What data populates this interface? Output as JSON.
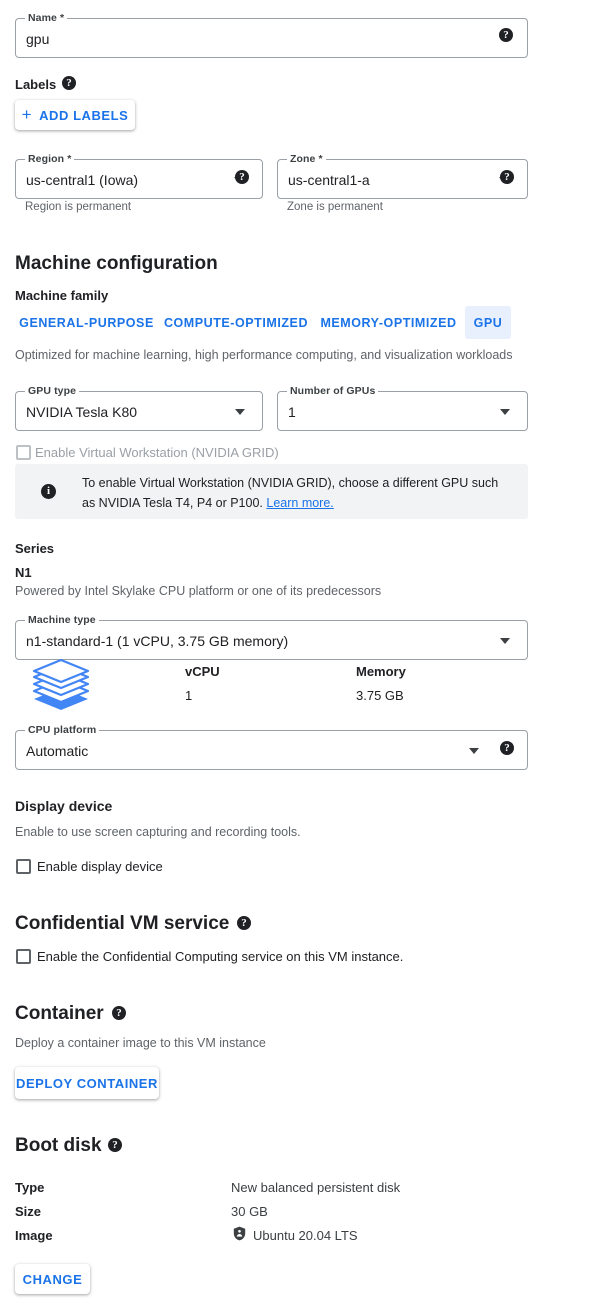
{
  "name_field": {
    "label": "Name *",
    "value": "gpu",
    "help_icon": "help-icon"
  },
  "labels_section": {
    "title": "Labels",
    "help_icon": "help-icon",
    "add_button": "ADD LABELS",
    "plus_icon": "plus-icon"
  },
  "region": {
    "label": "Region *",
    "value": "us-central1 (Iowa)",
    "helper": "Region is permanent",
    "caret_icon": "chevron-down-icon",
    "help_icon": "help-icon"
  },
  "zone": {
    "label": "Zone *",
    "value": "us-central1-a",
    "helper": "Zone is permanent",
    "caret_icon": "chevron-down-icon",
    "help_icon": "help-icon"
  },
  "machine_configuration": {
    "heading": "Machine configuration",
    "machine_family_label": "Machine family",
    "tabs": [
      {
        "label": "GENERAL-PURPOSE",
        "selected": false
      },
      {
        "label": "COMPUTE-OPTIMIZED",
        "selected": false
      },
      {
        "label": "MEMORY-OPTIMIZED",
        "selected": false
      },
      {
        "label": "GPU",
        "selected": true
      }
    ],
    "tab_description": "Optimized for machine learning, high performance computing, and visualization workloads",
    "gpu_type": {
      "label": "GPU type",
      "value": "NVIDIA Tesla K80",
      "caret_icon": "chevron-down-icon"
    },
    "number_of_gpus": {
      "label": "Number of GPUs",
      "value": "1",
      "caret_icon": "chevron-down-icon"
    },
    "virtual_workstation": {
      "checkbox_label": "Enable Virtual Workstation (NVIDIA GRID)",
      "checked": false,
      "disabled": true
    },
    "info_banner": {
      "icon": "info-icon",
      "text": "To enable Virtual Workstation (NVIDIA GRID), choose a different GPU such as NVIDIA Tesla T4, P4 or P100.",
      "link_text": "Learn more."
    },
    "series": {
      "heading": "Series",
      "name": "N1",
      "description": "Powered by Intel Skylake CPU platform or one of its predecessors"
    },
    "machine_type": {
      "label": "Machine type",
      "value": "n1-standard-1 (1 vCPU, 3.75 GB memory)",
      "caret_icon": "chevron-down-icon"
    },
    "specs": {
      "icon": "layers-icon",
      "columns": [
        "vCPU",
        "Memory"
      ],
      "values": [
        "1",
        "3.75 GB"
      ]
    },
    "cpu_platform": {
      "label": "CPU platform",
      "value": "Automatic",
      "caret_icon": "chevron-down-icon",
      "help_icon": "help-icon"
    }
  },
  "display_device": {
    "heading": "Display device",
    "description": "Enable to use screen capturing and recording tools.",
    "checkbox_label": "Enable display device",
    "checked": false
  },
  "confidential_vm": {
    "heading": "Confidential VM service",
    "help_icon": "help-icon",
    "checkbox_label": "Enable the Confidential Computing service on this VM instance.",
    "checked": false
  },
  "container": {
    "heading": "Container",
    "help_icon": "help-icon",
    "description": "Deploy a container image to this VM instance",
    "deploy_button": "DEPLOY CONTAINER"
  },
  "boot_disk": {
    "heading": "Boot disk",
    "help_icon": "help-icon",
    "rows": [
      {
        "key": "Type",
        "value": "New balanced persistent disk"
      },
      {
        "key": "Size",
        "value": "30 GB"
      },
      {
        "key": "Image",
        "value": "Ubuntu 20.04 LTS",
        "icon": "ubuntu-shield-icon"
      }
    ],
    "change_button": "CHANGE"
  },
  "colors": {
    "accent": "#1a73e8",
    "selected_tab_bg": "#e8f0fe",
    "info_bg": "#f1f3f4",
    "border": "#9aa0a6",
    "text_primary": "#202124",
    "text_secondary": "#5f6368"
  }
}
